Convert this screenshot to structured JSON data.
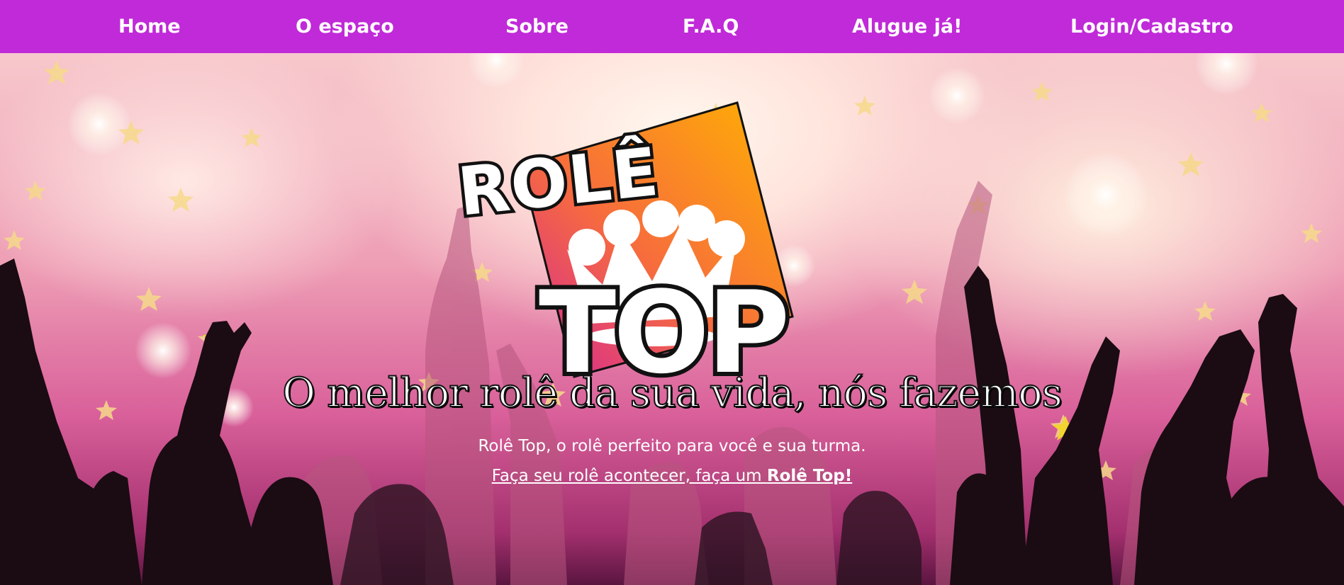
{
  "nav": {
    "items": [
      {
        "label": "Home"
      },
      {
        "label": "O espaço"
      },
      {
        "label": "Sobre"
      },
      {
        "label": "F.A.Q"
      },
      {
        "label": "Alugue já!"
      },
      {
        "label": "Login/Cadastro"
      }
    ]
  },
  "logo": {
    "word_top": "ROLÊ",
    "word_bottom": "TOP",
    "icon": "crown-icon"
  },
  "hero": {
    "tagline": "O melhor rolê da sua vida, nós fazemos",
    "subtitle": "Rolê Top, o rolê perfeito para você e sua turma.",
    "cta_prefix": "Faça seu rolê acontecer, faça um ",
    "cta_bold": "Rolê Top!"
  },
  "colors": {
    "nav_bg": "#c02ad8",
    "nav_text": "#ffffff",
    "logo_square_start": "#d4239a",
    "logo_square_end": "#ffb300",
    "text": "#ffffff"
  }
}
